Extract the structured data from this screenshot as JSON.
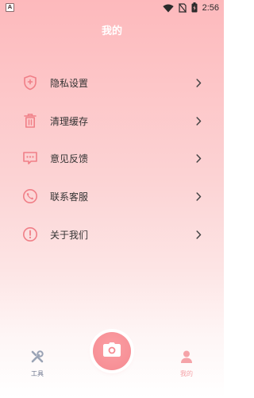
{
  "status_bar": {
    "app_indicator": "A",
    "time": "2:56"
  },
  "header": {
    "title": "我的"
  },
  "menu": {
    "items": [
      {
        "label": "隐私设置",
        "icon": "shield-icon"
      },
      {
        "label": "清理缓存",
        "icon": "trash-icon"
      },
      {
        "label": "意见反馈",
        "icon": "feedback-icon"
      },
      {
        "label": "联系客服",
        "icon": "phone-icon"
      },
      {
        "label": "关于我们",
        "icon": "info-icon"
      }
    ]
  },
  "bottom_nav": {
    "tools_label": "工具",
    "camera_icon": "camera-icon",
    "mine_label": "我的",
    "active_tab": "我的"
  },
  "colors": {
    "accent": "#f58a91",
    "icon": "#f07f87",
    "active_tab": "#f5a3a8",
    "inactive_tab": "#9aa3b5"
  }
}
